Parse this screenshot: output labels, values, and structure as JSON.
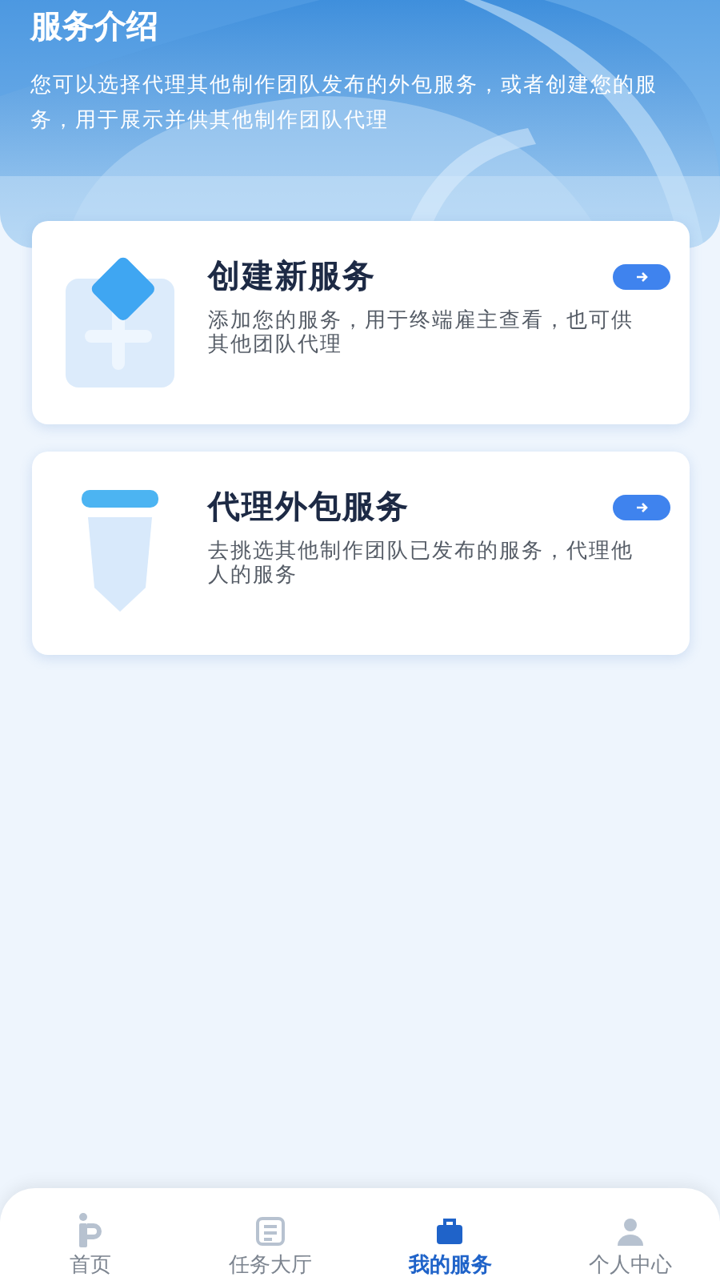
{
  "header": {
    "title": "服务介绍",
    "description": "您可以选择代理其他制作团队发布的外包服务，或者创建您的服务，用于展示并供其他制作团队代理"
  },
  "cards": [
    {
      "kind": "create",
      "title": "创建新服务",
      "description": "添加您的服务，用于终端雇主查看，也可供其他团队代理"
    },
    {
      "kind": "agent",
      "title": "代理外包服务",
      "description": "去挑选其他制作团队已发布的服务，代理他人的服务"
    }
  ],
  "tab_bar": [
    {
      "kind": "home",
      "label": "首页",
      "selected": false
    },
    {
      "kind": "tasks",
      "label": "任务大厅",
      "selected": false
    },
    {
      "kind": "services",
      "label": "我的服务",
      "selected": true
    },
    {
      "kind": "profile",
      "label": "个人中心",
      "selected": false
    }
  ]
}
